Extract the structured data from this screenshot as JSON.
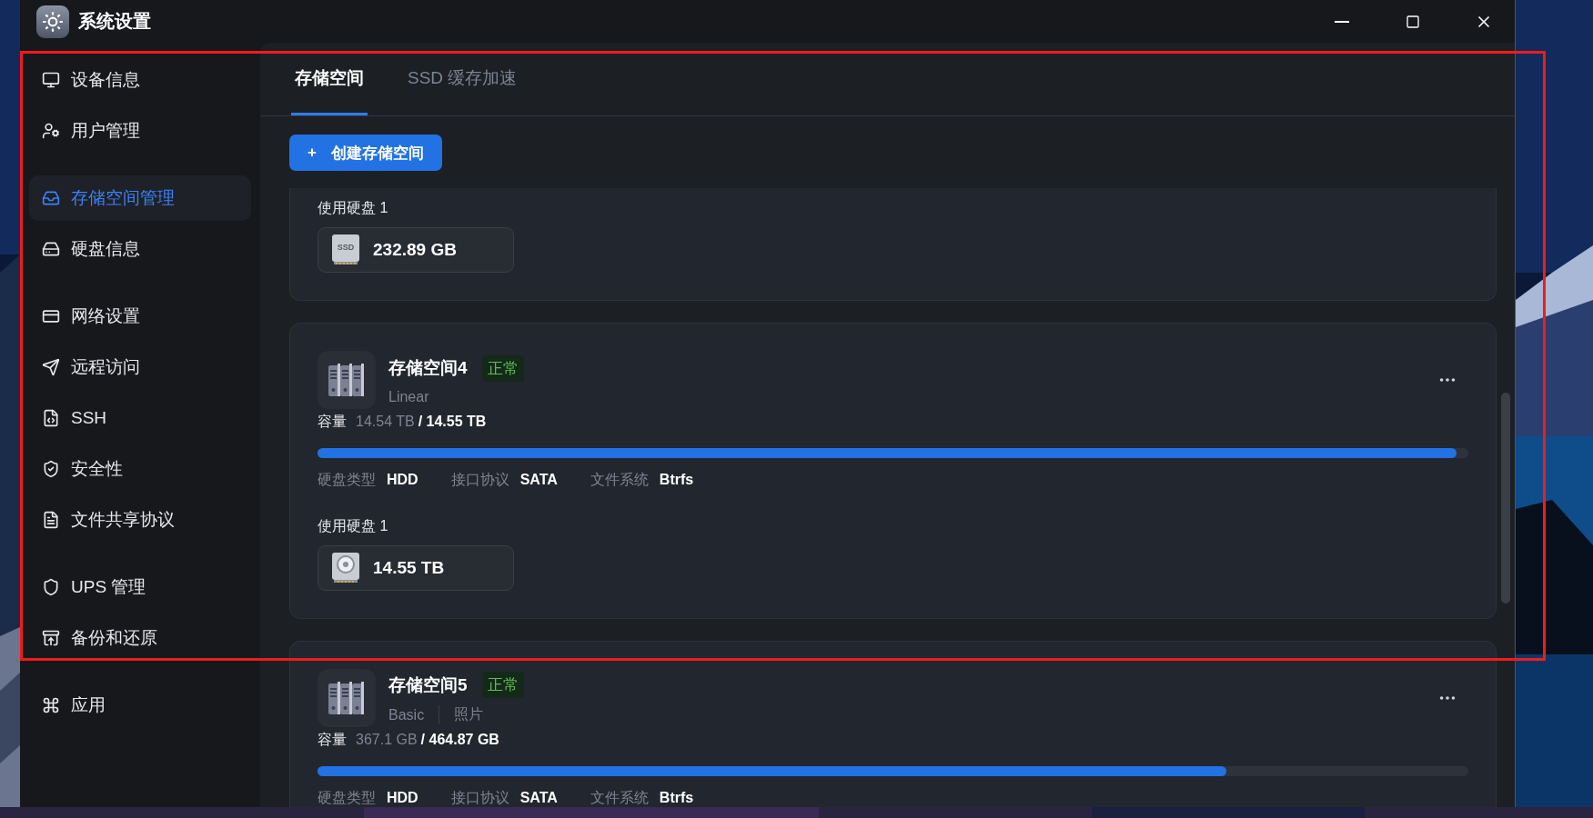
{
  "window": {
    "title": "系统设置"
  },
  "sidebar": {
    "groups": [
      {
        "items": [
          {
            "label": "设备信息",
            "selected": false
          },
          {
            "label": "用户管理",
            "selected": false
          }
        ]
      },
      {
        "items": [
          {
            "label": "存储空间管理",
            "selected": true
          },
          {
            "label": "硬盘信息",
            "selected": false
          }
        ]
      },
      {
        "items": [
          {
            "label": "网络设置",
            "selected": false
          },
          {
            "label": "远程访问",
            "selected": false
          },
          {
            "label": "SSH",
            "selected": false
          },
          {
            "label": "安全性",
            "selected": false
          },
          {
            "label": "文件共享协议",
            "selected": false
          }
        ]
      },
      {
        "items": [
          {
            "label": "UPS 管理",
            "selected": false
          },
          {
            "label": "备份和还原",
            "selected": false
          }
        ]
      },
      {
        "items": [
          {
            "label": "应用",
            "selected": false
          }
        ]
      }
    ]
  },
  "tabs": [
    {
      "label": "存储空间",
      "selected": true
    },
    {
      "label": "SSD 缓存加速",
      "selected": false
    }
  ],
  "create_button": {
    "icon": "+",
    "label": "创建存储空间"
  },
  "spaces": [
    {
      "kind": "partial",
      "disks_label": "使用硬盘 1",
      "disks": [
        {
          "kind": "ssd",
          "badge": "SSD",
          "size": "232.89 GB"
        }
      ]
    },
    {
      "kind": "full",
      "name": "存储空间4",
      "status": "正常",
      "tags": [
        "Linear"
      ],
      "capacity_label": "容量",
      "used": "14.54 TB",
      "total": "/ 14.55 TB",
      "level": 0.99,
      "meta": [
        {
          "label": "硬盘类型",
          "value": "HDD"
        },
        {
          "label": "接口协议",
          "value": "SATA"
        },
        {
          "label": "文件系统",
          "value": "Btrfs"
        }
      ],
      "disks_label": "使用硬盘 1",
      "disks": [
        {
          "kind": "hdd",
          "size": "14.55 TB"
        }
      ]
    },
    {
      "kind": "full",
      "name": "存储空间5",
      "status": "正常",
      "tags": [
        "Basic",
        "照片"
      ],
      "capacity_label": "容量",
      "used": "367.1 GB",
      "total": "/ 464.87 GB",
      "level": 0.79,
      "meta": [
        {
          "label": "硬盘类型",
          "value": "HDD"
        },
        {
          "label": "接口协议",
          "value": "SATA"
        },
        {
          "label": "文件系统",
          "value": "Btrfs"
        }
      ]
    }
  ]
}
